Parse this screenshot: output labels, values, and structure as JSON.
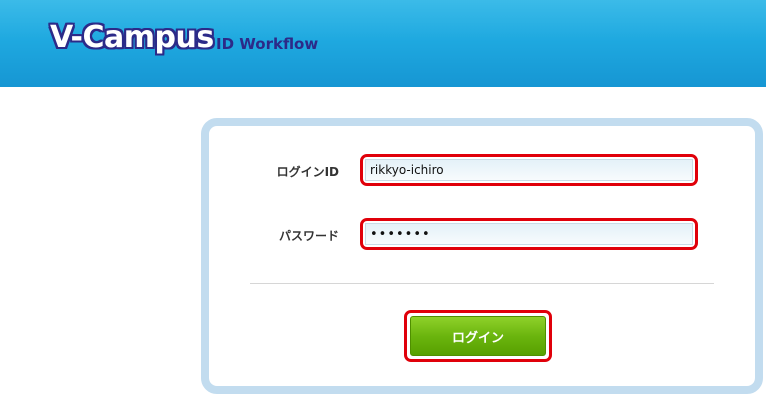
{
  "header": {
    "logo_text": "V-Campus",
    "subtitle": "ID Workflow"
  },
  "form": {
    "login_id": {
      "label": "ログインID",
      "value": "rikkyo-ichiro"
    },
    "password": {
      "label": "パスワード",
      "value": "•••••••"
    },
    "submit_label": "ログイン"
  },
  "colors": {
    "header_blue": "#1fa9e0",
    "logo_navy": "#2c2a88",
    "panel_border": "#c2dcef",
    "highlight_red": "#e0000a",
    "button_green": "#6bb50e"
  }
}
